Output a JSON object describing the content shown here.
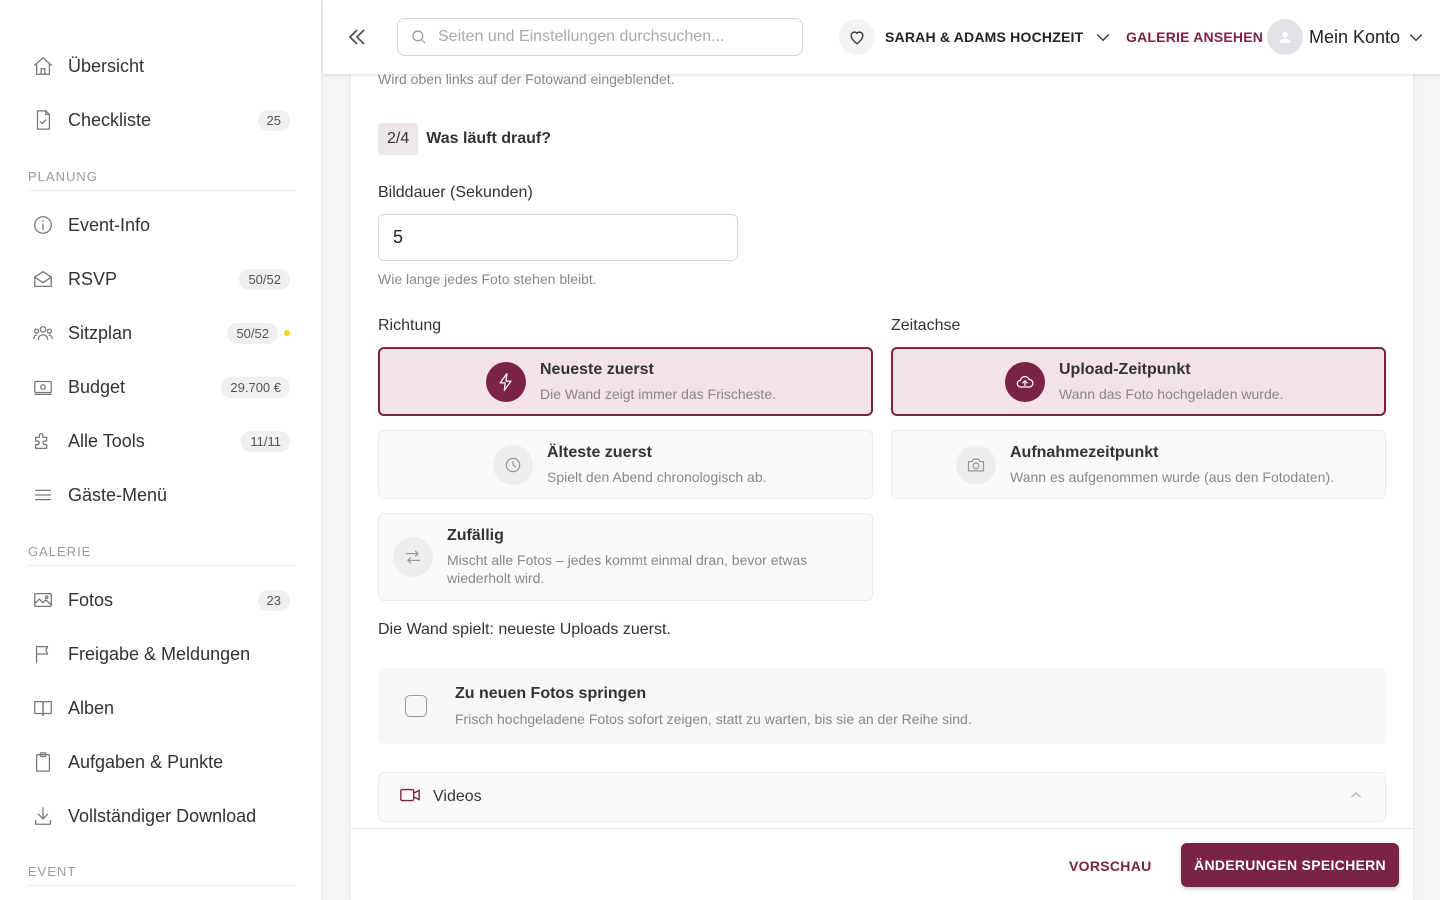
{
  "sidebar": {
    "items": [
      {
        "label": "Übersicht",
        "icon": "home-icon"
      },
      {
        "label": "Checkliste",
        "badge": "25",
        "icon": "checklist-icon"
      },
      {
        "label": "Event-Info",
        "icon": "info-icon"
      },
      {
        "label": "RSVP",
        "badge": "50/52",
        "icon": "envelope-icon"
      },
      {
        "label": "Sitzplan",
        "badge": "50/52",
        "icon": "people-icon"
      },
      {
        "label": "Budget",
        "badge": "29.700 €",
        "icon": "money-icon"
      },
      {
        "label": "Alle Tools",
        "badge": "11/11",
        "icon": "puzzle-icon"
      },
      {
        "label": "Gäste-Menü",
        "icon": "menu-icon"
      },
      {
        "label": "Fotos",
        "badge": "23",
        "icon": "image-icon"
      },
      {
        "label": "Freigabe & Meldungen",
        "icon": "flag-icon"
      },
      {
        "label": "Alben",
        "icon": "book-icon"
      },
      {
        "label": "Aufgaben & Punkte",
        "icon": "clipboard-icon"
      },
      {
        "label": "Vollständiger Download",
        "icon": "download-icon"
      }
    ],
    "sections": {
      "planung": "PLANUNG",
      "galerie": "GALERIE",
      "event": "EVENT"
    },
    "sitzplan_dot_color": "#f5d90a"
  },
  "header": {
    "search_placeholder": "Seiten und Einstellungen durchsuchen...",
    "event_name": "SARAH & ADAMS HOCHZEIT",
    "gallery_link": "GALERIE ANSEHEN",
    "account_label": "Mein Konto"
  },
  "content": {
    "top_helper": "Wird oben links auf der Fotowand eingeblendet.",
    "step_num": "2/4",
    "step_title": "Was läuft drauf?",
    "duration_label": "Bilddauer (Sekunden)",
    "duration_value": "5",
    "duration_helper": "Wie lange jedes Foto stehen bleibt.",
    "direction_label": "Richtung",
    "timeline_label": "Zeitachse",
    "direction_options": [
      {
        "title": "Neueste zuerst",
        "desc": "Die Wand zeigt immer das Frischeste.",
        "selected": true,
        "icon": "lightning-icon"
      },
      {
        "title": "Älteste zuerst",
        "desc": "Spielt den Abend chronologisch ab.",
        "selected": false,
        "icon": "clock-icon"
      },
      {
        "title": "Zufällig",
        "desc": "Mischt alle Fotos – jedes kommt einmal dran, bevor etwas wiederholt wird.",
        "selected": false,
        "icon": "shuffle-icon"
      }
    ],
    "timeline_options": [
      {
        "title": "Upload-Zeitpunkt",
        "desc": "Wann das Foto hochgeladen wurde.",
        "selected": true,
        "icon": "cloud-upload-icon"
      },
      {
        "title": "Aufnahmezeitpunkt",
        "desc": "Wann es aufgenommen wurde (aus den Fotodaten).",
        "selected": false,
        "icon": "camera-icon"
      }
    ],
    "summary": "Die Wand spielt: neueste Uploads zuerst.",
    "jump_title": "Zu neuen Fotos springen",
    "jump_desc": "Frisch hochgeladene Fotos sofort zeigen, statt zu warten, bis sie an der Reihe sind.",
    "videos_label": "Videos"
  },
  "footer": {
    "preview": "VORSCHAU",
    "save": "ÄNDERUNGEN SPEICHERN"
  },
  "colors": {
    "accent": "#7b2346",
    "selected_bg": "#f3e3e8"
  }
}
